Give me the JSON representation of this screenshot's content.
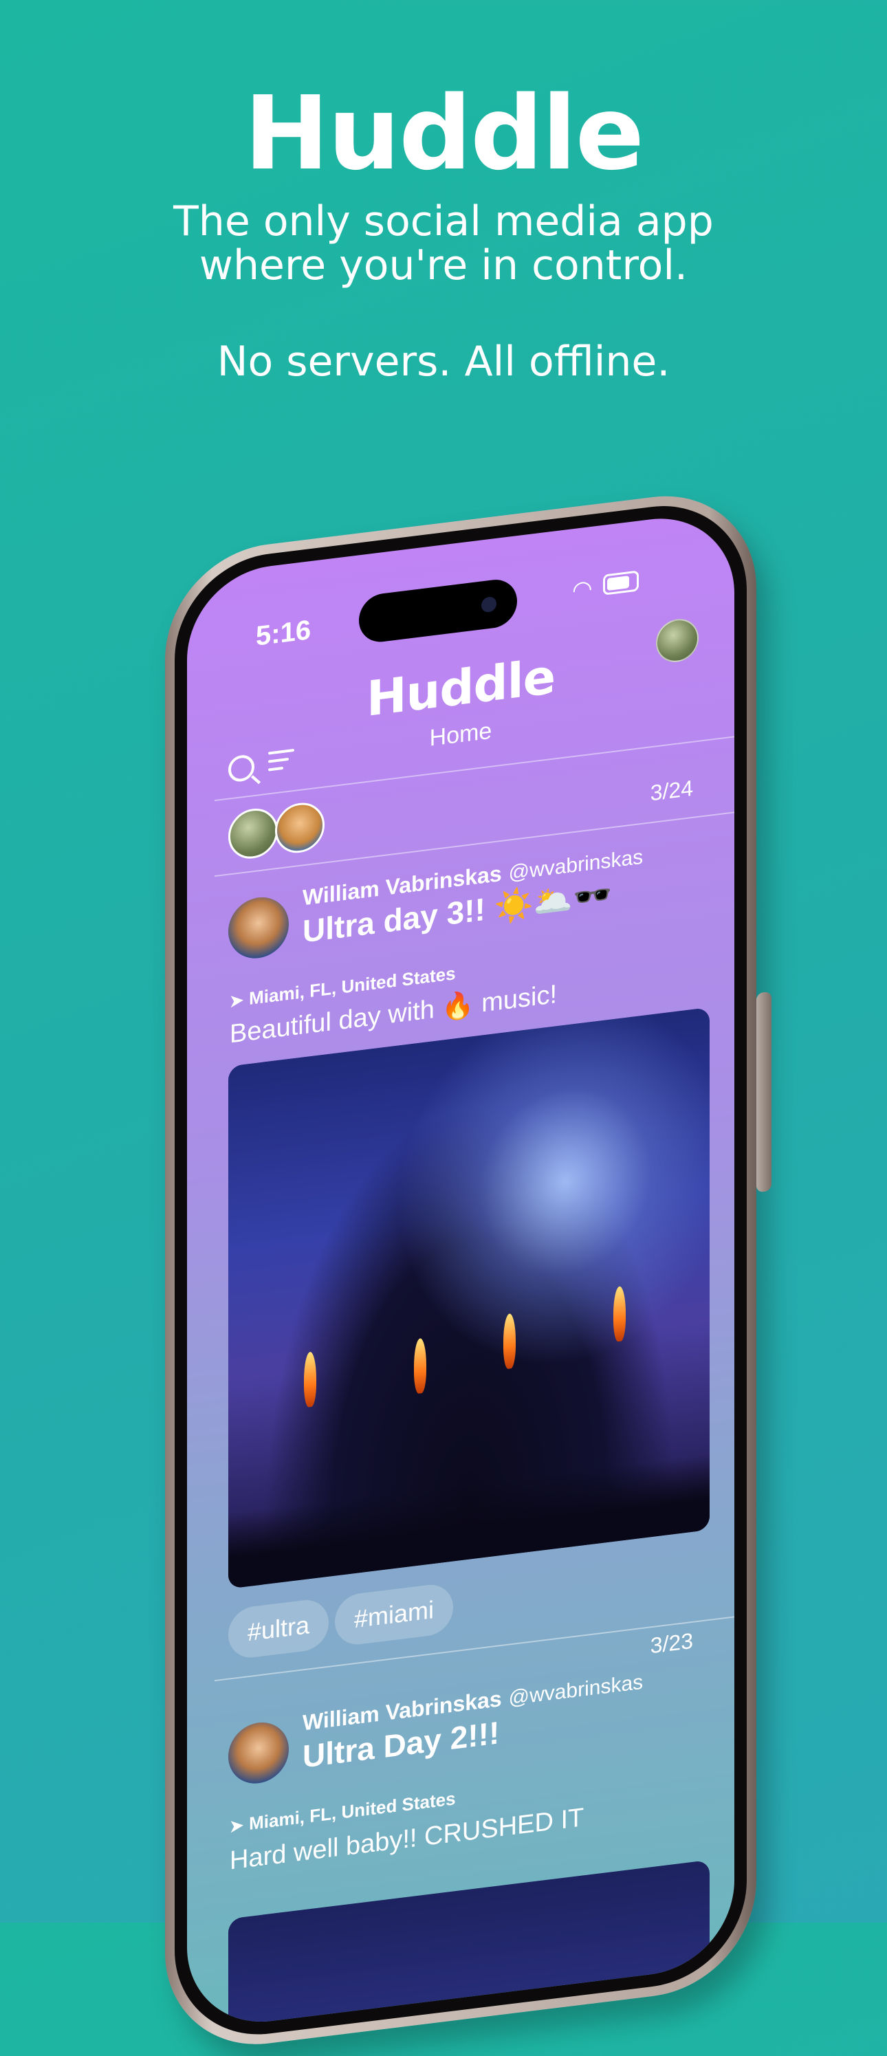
{
  "hero": {
    "title": "Huddle",
    "subtitle_line1": "The only social media app",
    "subtitle_line2": "where you're in control.",
    "tagline": "No servers. All offline."
  },
  "status_bar": {
    "time": "5:16",
    "wifi_icon": "wifi-icon",
    "battery_icon": "battery-icon"
  },
  "app": {
    "title": "Huddle",
    "subtitle": "Home"
  },
  "posts": [
    {
      "date": "3/24",
      "author_name": "William Vabrinskas",
      "author_handle": "@wvabrinskas",
      "title": "Ultra day 3!! ☀️🌥️🕶️",
      "location": "Miami, FL, United States",
      "text": "Beautiful day with 🔥 music!",
      "tags": [
        "#ultra",
        "#miami"
      ]
    },
    {
      "date": "3/23",
      "author_name": "William Vabrinskas",
      "author_handle": "@wvabrinskas",
      "title": "Ultra Day 2!!!",
      "location": "Miami, FL, United States",
      "text": "Hard well baby!! CRUSHED IT"
    }
  ],
  "colors": {
    "background": "#1db7a1",
    "screen_top": "#c084f5",
    "screen_bottom": "#6cb7bd",
    "text": "#ffffff"
  }
}
